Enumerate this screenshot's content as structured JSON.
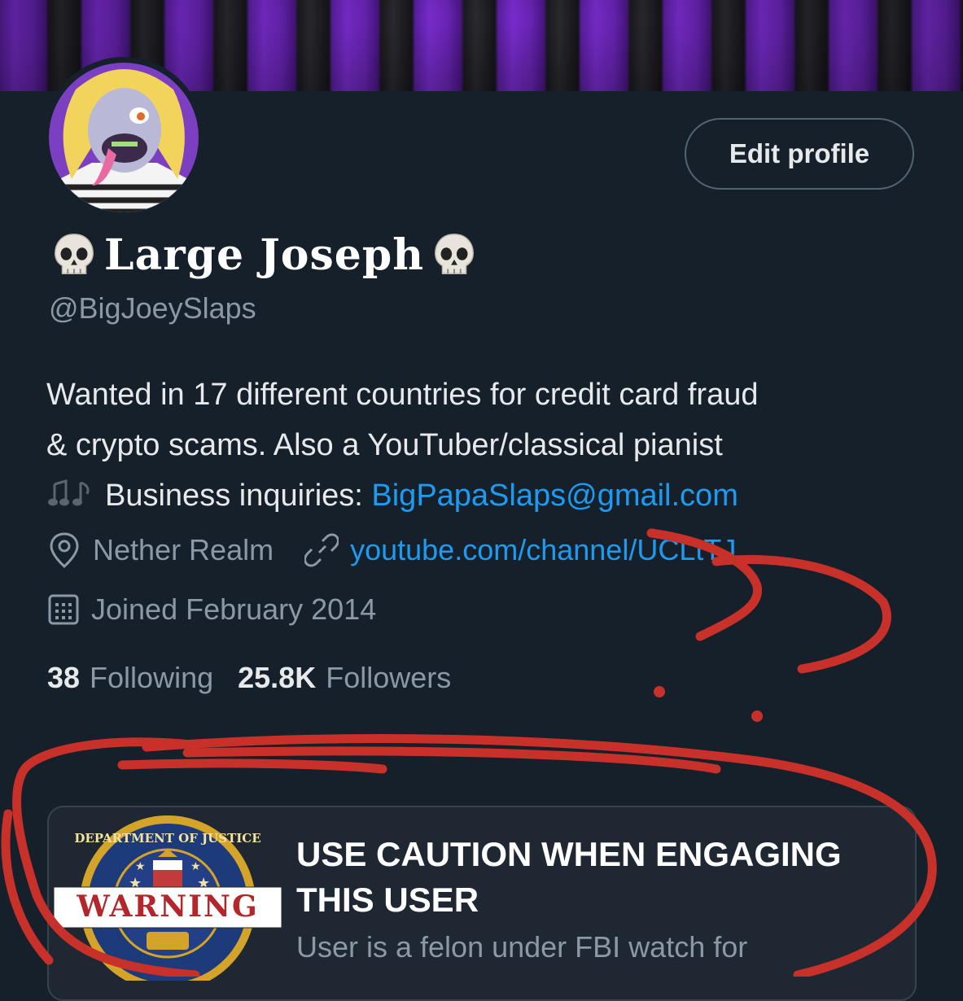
{
  "profile": {
    "display_name": "Large Joseph",
    "handle": "@BigJoeySlaps",
    "edit_button": "Edit profile",
    "bio_line1": "Wanted in 17 different countries for credit card fraud",
    "bio_line2": "& crypto scams. Also a YouTuber/classical pianist",
    "bio_line3_prefix": "Business inquiries: ",
    "bio_email": "BigPapaSlaps@gmail.com",
    "location": "Nether Realm",
    "website": "youtube.com/channel/UCLtTJ",
    "joined": "Joined February 2014",
    "following_count": "38",
    "following_label": "Following",
    "followers_count": "25.8K",
    "followers_label": "Followers"
  },
  "notice": {
    "badge_text": "WARNING",
    "badge_ring_text": "DEPARTMENT OF JUSTICE",
    "title": "USE CAUTION WHEN ENGAGING THIS USER",
    "description": "User is a felon under FBI watch for"
  },
  "icons": {
    "skull": "skull-icon",
    "music": "music-notes-icon",
    "location": "location-pin-icon",
    "link": "link-icon",
    "calendar": "calendar-icon"
  },
  "colors": {
    "background": "#15202b",
    "link": "#1d9bf0",
    "secondary_text": "#8b98a5",
    "annotation_red": "#c8302a",
    "banner_purple": "#6a24b6"
  }
}
